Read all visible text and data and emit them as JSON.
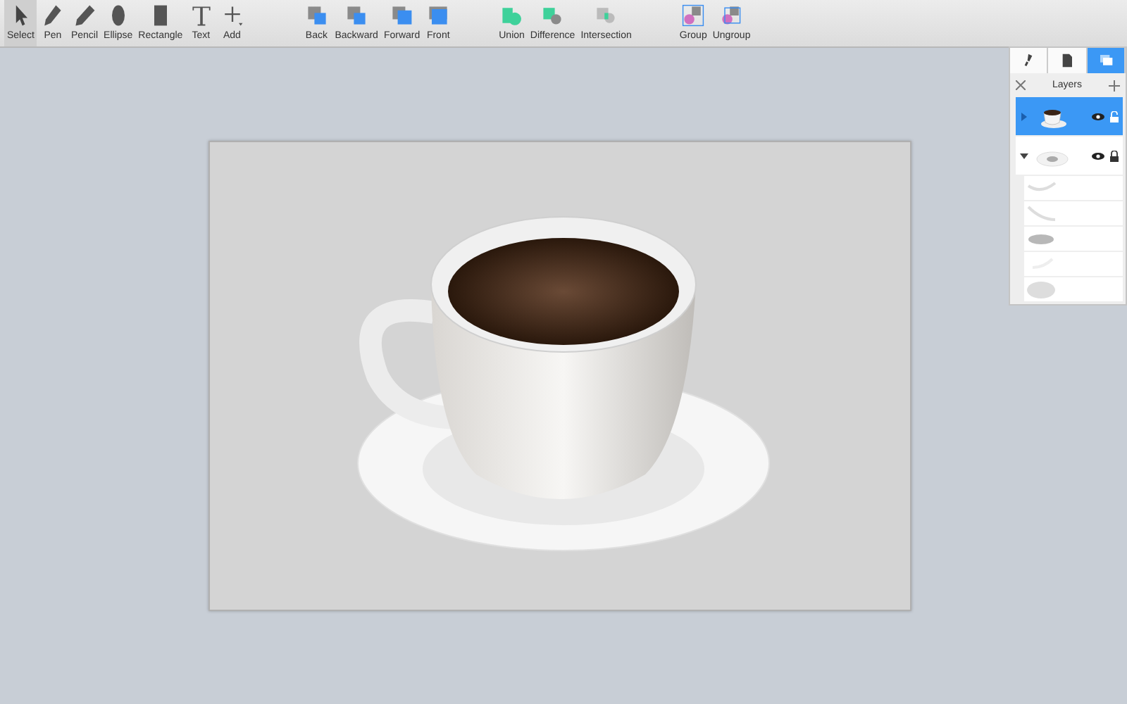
{
  "toolbar": {
    "groups": [
      {
        "tools": [
          {
            "label": "Select",
            "kind": "pointer",
            "selected": true
          },
          {
            "label": "Pen",
            "kind": "pen",
            "selected": false
          },
          {
            "label": "Pencil",
            "kind": "pencil",
            "selected": false
          },
          {
            "label": "Ellipse",
            "kind": "ellipse",
            "selected": false
          },
          {
            "label": "Rectangle",
            "kind": "rectangle",
            "selected": false
          },
          {
            "label": "Text",
            "kind": "text",
            "selected": false
          },
          {
            "label": "Add",
            "kind": "plus",
            "selected": false
          }
        ]
      },
      {
        "tools": [
          {
            "label": "Back",
            "kind": "back",
            "selected": false
          },
          {
            "label": "Backward",
            "kind": "backward",
            "selected": false
          },
          {
            "label": "Forward",
            "kind": "forward",
            "selected": false
          },
          {
            "label": "Front",
            "kind": "front",
            "selected": false
          }
        ]
      },
      {
        "tools": [
          {
            "label": "Union",
            "kind": "union",
            "selected": false
          },
          {
            "label": "Difference",
            "kind": "difference",
            "selected": false
          },
          {
            "label": "Intersection",
            "kind": "intersection",
            "selected": false
          }
        ]
      },
      {
        "tools": [
          {
            "label": "Group",
            "kind": "group",
            "selected": false
          },
          {
            "label": "Ungroup",
            "kind": "ungroup",
            "selected": false
          }
        ]
      }
    ]
  },
  "layers_panel": {
    "tabs": [
      {
        "kind": "brush",
        "selected": false
      },
      {
        "kind": "document",
        "selected": false
      },
      {
        "kind": "layers",
        "selected": true
      }
    ],
    "title": "Layers",
    "layers": [
      {
        "kind": "cup",
        "selected": true,
        "expanded": false,
        "visible": true,
        "locked": false
      },
      {
        "kind": "saucer",
        "selected": false,
        "expanded": true,
        "visible": true,
        "locked": true,
        "children": [
          {
            "kind": "arc"
          },
          {
            "kind": "streak"
          },
          {
            "kind": "blur"
          },
          {
            "kind": "faint"
          },
          {
            "kind": "disc"
          }
        ]
      }
    ]
  }
}
